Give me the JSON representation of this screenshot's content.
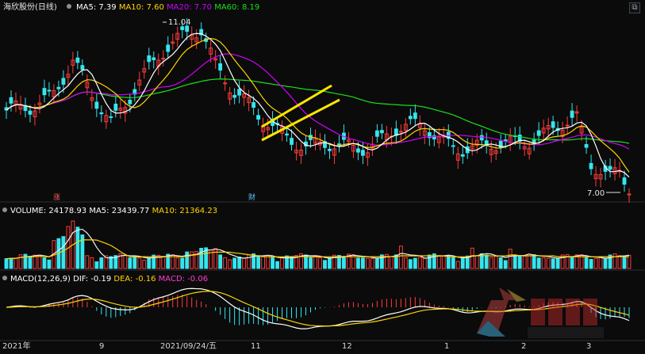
{
  "chart_data": {
    "type": "candlestick",
    "title": "海欣股份(日线)",
    "legend_labels": [
      {
        "label": "MA5: 7.39",
        "color": "#ffffff"
      },
      {
        "label": "MA10: 7.60",
        "color": "#ffd400"
      },
      {
        "label": "MA20: 7.70",
        "color": "#d000ff"
      },
      {
        "label": "MA60: 8.19",
        "color": "#1be01b"
      }
    ],
    "annotations": {
      "high": "11.04",
      "low": "7.00",
      "event_left": "涨",
      "event_right": "财"
    },
    "volume_header": [
      {
        "label": "VOLUME: 24178.93",
        "color": "#ffffff"
      },
      {
        "label": "MA5: 23439.77",
        "color": "#ffffff"
      },
      {
        "label": "MA10: 21364.23",
        "color": "#ffd400"
      }
    ],
    "macd_header": [
      {
        "label": "MACD(12,26,9)",
        "color": "#ffffff"
      },
      {
        "label": "DIF: -0.19",
        "color": "#ffffff"
      },
      {
        "label": "DEA: -0.16",
        "color": "#ffd400"
      },
      {
        "label": "MACD: -0.06",
        "color": "#ff3bd3"
      }
    ],
    "x_ticks": [
      "2021年",
      "9",
      "2021/09/24/五",
      "11",
      "12",
      "1",
      "2",
      "3"
    ],
    "colors": {
      "up": "#ff3b3b",
      "down": "#35e6ef",
      "ma5": "#ffffff",
      "ma10": "#ffd400",
      "ma20": "#d000ff",
      "ma60": "#1be01b",
      "trend": "#ffe600"
    },
    "price_range": [
      6.7,
      11.3
    ],
    "volume_max": 100000
  }
}
